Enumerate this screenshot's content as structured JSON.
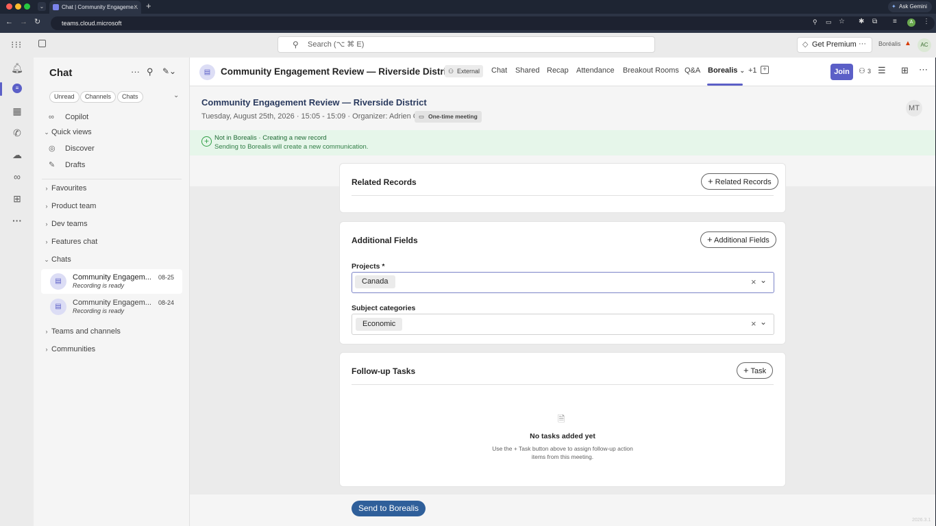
{
  "browser": {
    "tab_title": "Chat | Community Engageme...",
    "url": "teams.cloud.microsoft",
    "ask_gemini": "Ask Gemini"
  },
  "topbar": {
    "search_placeholder": "Search (⌥ ⌘ E)",
    "premium_label": "Get Premium",
    "org_name": "Boréalis",
    "avatar_initials": "AC"
  },
  "left": {
    "title": "Chat",
    "filters": [
      "Unread",
      "Channels",
      "Chats"
    ],
    "copilot": "Copilot",
    "quick_views": "Quick views",
    "discover": "Discover",
    "drafts": "Drafts",
    "favourites": "Favourites",
    "product_team": "Product team",
    "dev_teams": "Dev teams",
    "features_chat": "Features chat",
    "chats": "Chats",
    "chat_items": [
      {
        "title": "Community Engagem...",
        "subtitle": "Recording is ready",
        "date": "08-25"
      },
      {
        "title": "Community Engagem...",
        "subtitle": "Recording is ready",
        "date": "08-24"
      }
    ],
    "teams_channels": "Teams and channels",
    "communities": "Communities"
  },
  "header": {
    "title": "Community Engagement Review — Riverside District",
    "external": "External",
    "tabs": [
      "Chat",
      "Shared",
      "Recap",
      "Attendance",
      "Breakout Rooms",
      "Q&A",
      "Borealis"
    ],
    "more_tabs": "+1",
    "join": "Join",
    "participants": "3"
  },
  "meeting": {
    "title": "Community Engagement Review — Riverside District",
    "details": "Tuesday, August 25th, 2026 · 15:05 - 15:09 · Organizer: Adrien Carré",
    "badge": "One-time meeting",
    "avatar": "MT"
  },
  "banner": {
    "title": "Not in Borealis · Creating a new record",
    "subtitle": "Sending to Borealis will create a new communication."
  },
  "related": {
    "title": "Related Records",
    "button": "Related Records"
  },
  "additional": {
    "title": "Additional Fields",
    "button": "Additional Fields",
    "projects_label": "Projects *",
    "projects_value": "Canada",
    "subjects_label": "Subject categories",
    "subjects_value": "Economic"
  },
  "tasks": {
    "title": "Follow-up Tasks",
    "button": "Task",
    "empty_title": "No tasks added yet",
    "empty_line1": "Use the + Task button above to assign follow-up action",
    "empty_line2": "items from this meeting."
  },
  "send_button": "Send to Borealis",
  "version": "2026.3.1",
  "colors": {
    "accent": "#5b5fc7",
    "send": "#2f5f9a",
    "banner": "#e6f6ea",
    "banner_text": "#1e6b34"
  }
}
